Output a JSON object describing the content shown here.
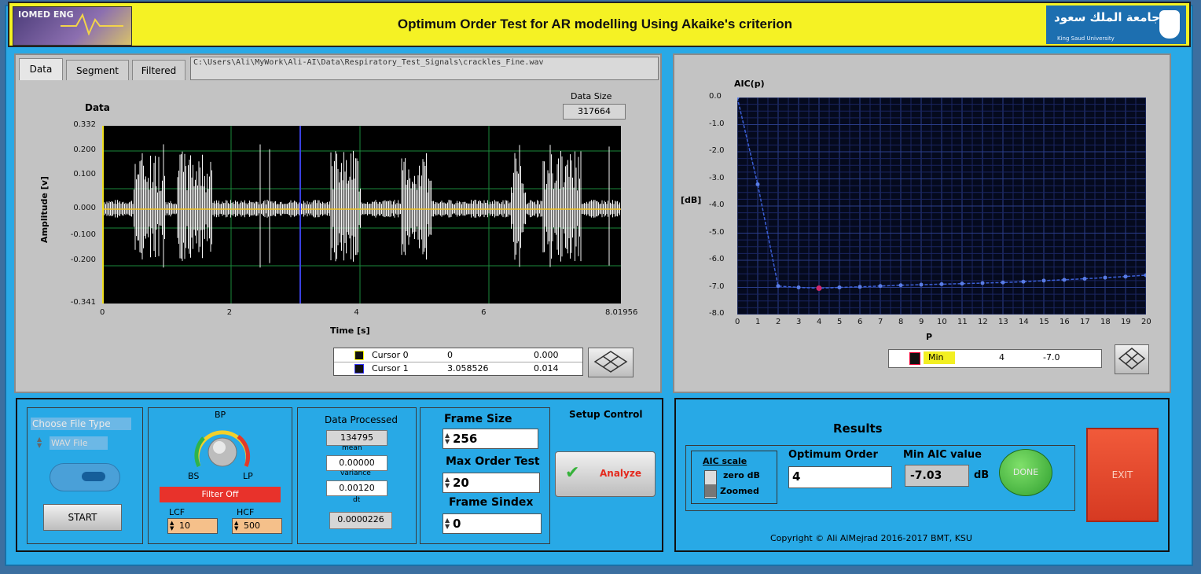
{
  "header": {
    "title": "Optimum Order Test  for AR modelling Using Akaike's criterion",
    "logo_left_text": "IOMED ENG",
    "logo_right_arabic": "جامعة الملك سعود",
    "logo_right_english": "King Saud University"
  },
  "left_panel": {
    "tabs": [
      {
        "label": "Data"
      },
      {
        "label": "Segment"
      },
      {
        "label": "Filtered"
      }
    ],
    "file_path": "C:\\Users\\Ali\\MyWork\\Ali-AI\\Data\\Respiratory_Test_Signals\\crackles_Fine.wav",
    "chart_title": "Data",
    "data_size_label": "Data Size",
    "data_size_value": "317664",
    "y_axis_label": "Amplitude [v]",
    "x_axis_label": "Time [s]",
    "y_ticks": [
      "0.332",
      "0.200",
      "0.100",
      "0.000",
      "-0.100",
      "-0.200",
      "-0.341"
    ],
    "x_ticks": [
      "0",
      "2",
      "4",
      "6",
      "8.01956"
    ],
    "cursors": [
      {
        "name": "Cursor 0",
        "x": "0",
        "y": "0.000"
      },
      {
        "name": "Cursor 1",
        "x": "3.058526",
        "y": "0.014"
      }
    ]
  },
  "chart_data": {
    "type": "line",
    "title": "AIC(p)",
    "xlabel": "P",
    "ylabel": "[dB]",
    "xlim": [
      0,
      20
    ],
    "ylim": [
      -8.0,
      0.0
    ],
    "grid": true,
    "x_ticks": [
      "0",
      "1",
      "2",
      "3",
      "4",
      "5",
      "6",
      "7",
      "8",
      "9",
      "10",
      "11",
      "12",
      "13",
      "14",
      "15",
      "16",
      "17",
      "18",
      "19",
      "20"
    ],
    "y_ticks": [
      "0.0",
      "-1.0",
      "-2.0",
      "-3.0",
      "-4.0",
      "-5.0",
      "-6.0",
      "-7.0",
      "-8.0"
    ],
    "x": [
      0,
      1,
      2,
      3,
      4,
      5,
      6,
      7,
      8,
      9,
      10,
      11,
      12,
      13,
      14,
      15,
      16,
      17,
      18,
      19,
      20
    ],
    "series": [
      {
        "values": [
          0.0,
          -3.2,
          -6.95,
          -7.0,
          -7.03,
          -7.0,
          -6.98,
          -6.95,
          -6.92,
          -6.9,
          -6.88,
          -6.86,
          -6.84,
          -6.82,
          -6.79,
          -6.75,
          -6.72,
          -6.68,
          -6.64,
          -6.6,
          -6.55
        ]
      }
    ],
    "min_marker": {
      "x": 4,
      "y": -7.03
    }
  },
  "right_panel": {
    "marker_legend": "Min",
    "marker_x": "4",
    "marker_y": "-7.0"
  },
  "file_section": {
    "label": "Choose File Type",
    "file_type_value": "WAV File",
    "start_button": "START"
  },
  "filter_section": {
    "knob_top": "BP",
    "knob_left": "BS",
    "knob_right": "LP",
    "filter_button": "Filter Off",
    "lcf_label": "LCF",
    "lcf_value": "10",
    "hcf_label": "HCF",
    "hcf_value": "500"
  },
  "stats_section": {
    "data_processed_label": "Data Processed",
    "data_processed_value": "134795",
    "mean_label": "mean",
    "mean_value": "0.00000",
    "variance_label": "variance",
    "variance_value": "0.00120",
    "dt_label": "dt",
    "dt_value": "0.0000226"
  },
  "frame_section": {
    "frame_size_label": "Frame Size",
    "frame_size_value": "256",
    "max_order_label": "Max Order Test",
    "max_order_value": "20",
    "frame_index_label": "Frame Sindex",
    "frame_index_value": "0"
  },
  "setup_section": {
    "title": "Setup Control",
    "analyze_button": "Analyze"
  },
  "results_section": {
    "title": "Results",
    "aic_scale_label": "AIC scale",
    "aic_scale_option1": "zero dB",
    "aic_scale_option2": "Zoomed",
    "optimum_order_label": "Optimum  Order",
    "optimum_order_value": "4",
    "min_aic_label": "Min AIC value",
    "min_aic_value": "-7.03",
    "min_aic_unit": "dB",
    "done_button": "DONE",
    "exit_button": "EXIT",
    "copyright": "Copyright © Ali AlMejrad 2016-2017 BMT, KSU"
  },
  "colors": {
    "background": "#29a9e6",
    "header": "#f5f224",
    "exit": "#e8432e",
    "done": "#37b335",
    "filter_off": "#e8322b",
    "plot_grid": "#1c8a3c",
    "aic_line": "#3b5fd6"
  }
}
